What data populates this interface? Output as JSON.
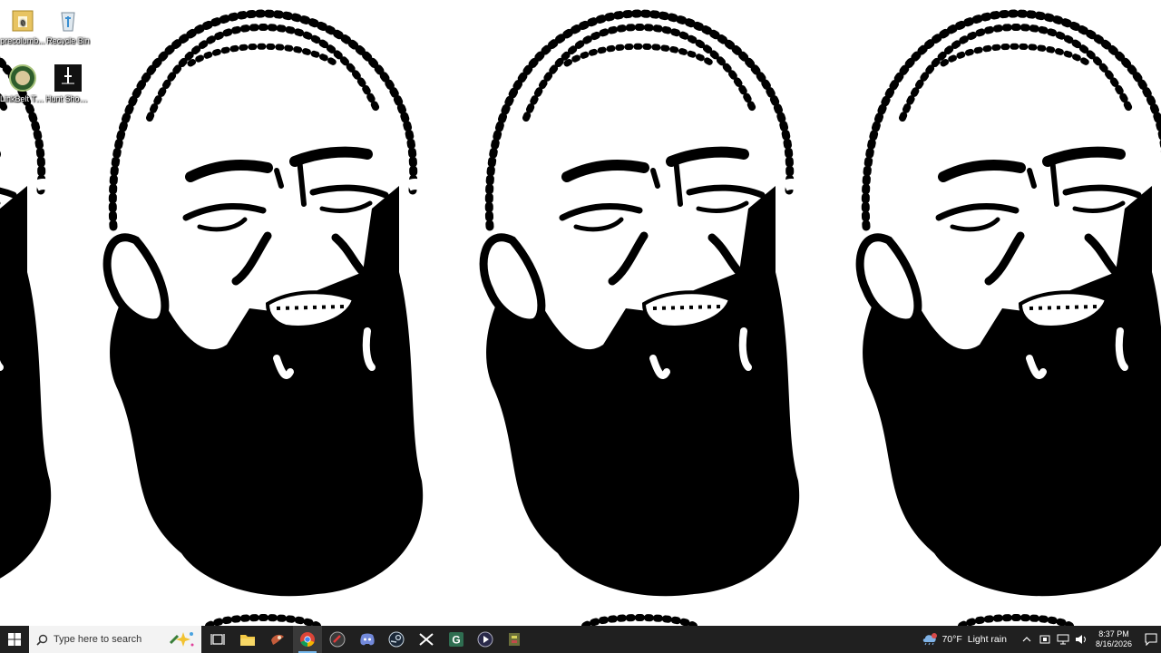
{
  "desktop": {
    "icons": [
      {
        "label": "precolumb...",
        "icon": "folder-icon"
      },
      {
        "label": "Recycle Bin",
        "icon": "recycle-bin-icon"
      },
      {
        "label": "LinkBelt Twitch...",
        "icon": "app-shortcut-icon"
      },
      {
        "label": "Hunt Showdown",
        "icon": "game-shortcut-icon"
      }
    ]
  },
  "taskbar": {
    "search_placeholder": "Type here to search",
    "pinned": [
      {
        "name": "task-view",
        "icon": "task-view-icon"
      },
      {
        "name": "file-explorer",
        "icon": "folder-icon"
      },
      {
        "name": "app",
        "icon": "app-icon"
      },
      {
        "name": "chrome",
        "icon": "chrome-icon",
        "active": true
      },
      {
        "name": "app-2",
        "icon": "app-icon"
      },
      {
        "name": "discord",
        "icon": "discord-icon"
      },
      {
        "name": "steam",
        "icon": "steam-icon"
      },
      {
        "name": "capcut",
        "icon": "capcut-icon"
      },
      {
        "name": "g-app",
        "icon": "g-app-icon"
      },
      {
        "name": "media-player",
        "icon": "play-icon"
      },
      {
        "name": "app-3",
        "icon": "app-icon"
      }
    ],
    "weather": {
      "temp": "70°F",
      "condition": "Light rain",
      "icon": "rain-cloud-icon"
    },
    "clock": {
      "time": "8:37 PM",
      "date": "8/16/2026"
    }
  },
  "colors": {
    "taskbar_bg": "#202020",
    "search_bg": "#f3f3f3",
    "active_indicator": "#76b9ed",
    "wallpaper_ink": "#000000",
    "wallpaper_bg": "#ffffff"
  }
}
